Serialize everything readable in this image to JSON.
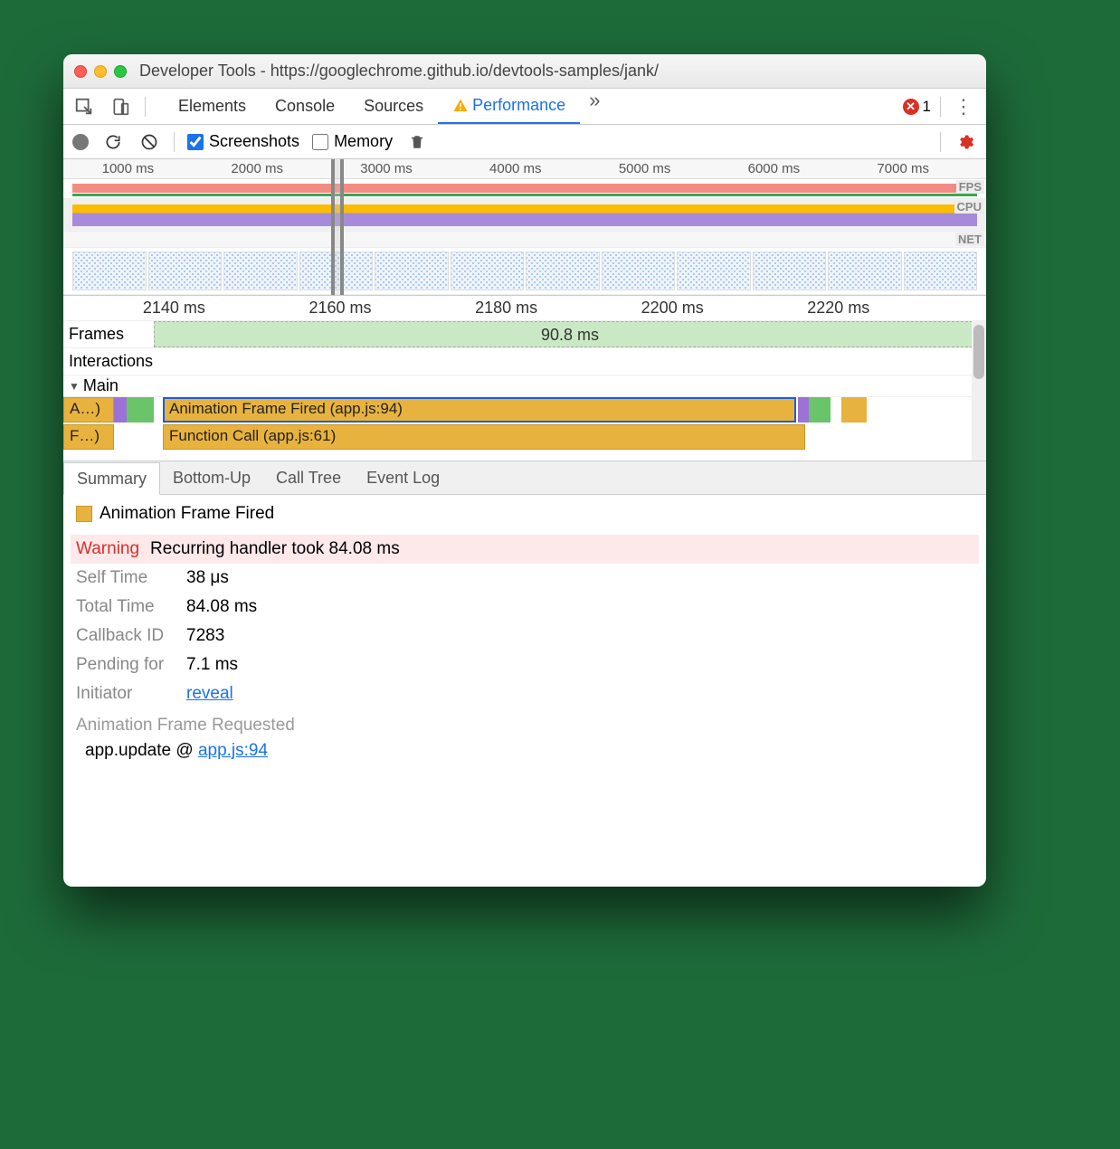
{
  "window_title": "Developer Tools - https://googlechrome.github.io/devtools-samples/jank/",
  "tabs": {
    "elements": "Elements",
    "console": "Console",
    "sources": "Sources",
    "performance": "Performance"
  },
  "error_count": "1",
  "toolbar2": {
    "screenshots": "Screenshots",
    "memory": "Memory"
  },
  "overview": {
    "ticks": [
      "1000 ms",
      "2000 ms",
      "3000 ms",
      "4000 ms",
      "5000 ms",
      "6000 ms",
      "7000 ms"
    ],
    "labels": {
      "fps": "FPS",
      "cpu": "CPU",
      "net": "NET"
    }
  },
  "detail_ticks": [
    "2140 ms",
    "2160 ms",
    "2180 ms",
    "2200 ms",
    "2220 ms"
  ],
  "tracks": {
    "frames": "Frames",
    "frames_value": "90.8 ms",
    "interactions": "Interactions",
    "main": "Main"
  },
  "flame": {
    "stub1": "A…)",
    "stub2": "F…)",
    "anim": "Animation Frame Fired (app.js:94)",
    "func": "Function Call (app.js:61)"
  },
  "subtabs": {
    "summary": "Summary",
    "bottomup": "Bottom-Up",
    "calltree": "Call Tree",
    "eventlog": "Event Log"
  },
  "summary": {
    "title": "Animation Frame Fired",
    "warning_label": "Warning",
    "warning_text": "Recurring handler took 84.08 ms",
    "self_time_label": "Self Time",
    "self_time": "38 μs",
    "total_time_label": "Total Time",
    "total_time": "84.08 ms",
    "callback_label": "Callback ID",
    "callback": "7283",
    "pending_label": "Pending for",
    "pending": "7.1 ms",
    "initiator_label": "Initiator",
    "initiator_link": "reveal",
    "requested": "Animation Frame Requested",
    "stack_fn": "app.update @ ",
    "stack_link": "app.js:94"
  }
}
